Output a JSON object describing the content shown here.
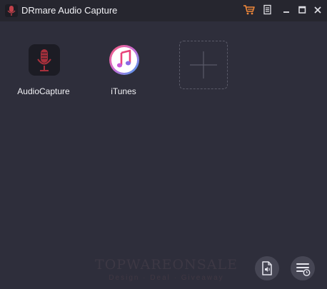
{
  "window": {
    "title": "DRmare Audio Capture"
  },
  "titlebar": {
    "icons": [
      "cart-icon",
      "menu-icon",
      "minimize-icon",
      "maximize-icon",
      "close-icon"
    ],
    "cart_color": "#f0883a"
  },
  "apps": [
    {
      "label": "AudioCapture",
      "icon": "microphone-icon"
    },
    {
      "label": "iTunes",
      "icon": "itunes-icon"
    }
  ],
  "add_app": {
    "icon": "plus-icon"
  },
  "watermark": {
    "text": "TOPWAREONSALE",
    "sub": "Design · Deal · Giveaway"
  },
  "bottom_buttons": [
    "audio-file-icon",
    "task-list-icon"
  ],
  "colors": {
    "background": "#2e2e3b",
    "titlebar": "#26262f",
    "accent": "#f0883a"
  }
}
